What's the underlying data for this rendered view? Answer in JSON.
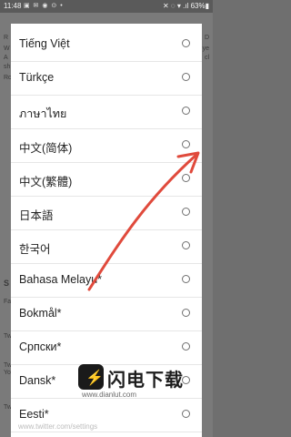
{
  "status_bar": {
    "time": "11:48",
    "notification_icons": "▣ ✉ ◉ ⊙ •",
    "right": "✕ ◌ ▾ .ıl 63%▮"
  },
  "background": {
    "left_letters": [
      "R",
      "W",
      "A",
      "sh",
      "Ro",
      "S",
      "Fa",
      "Tw",
      "Tw",
      "Yo",
      "Tw"
    ],
    "right_letters": [
      "D",
      "ye",
      "cl"
    ]
  },
  "languages": [
    {
      "label": "Tiếng Việt"
    },
    {
      "label": "Türkçe"
    },
    {
      "label": "ภาษาไทย"
    },
    {
      "label": "中文(简体)"
    },
    {
      "label": "中文(繁體)"
    },
    {
      "label": "日本語"
    },
    {
      "label": "한국어"
    },
    {
      "label": "Bahasa Melayu*"
    },
    {
      "label": "Bokmål*"
    },
    {
      "label": "Српски*"
    },
    {
      "label": "Dansk*"
    },
    {
      "label": "Eesti*"
    }
  ],
  "watermark": {
    "brand": "闪电下载",
    "url": "www.dianlut.com"
  },
  "bottom_text": "www.twitter.com/settings",
  "colors": {
    "arrow": "#e04a3c",
    "dialog_bg": "#ffffff",
    "radio": "#707070"
  }
}
